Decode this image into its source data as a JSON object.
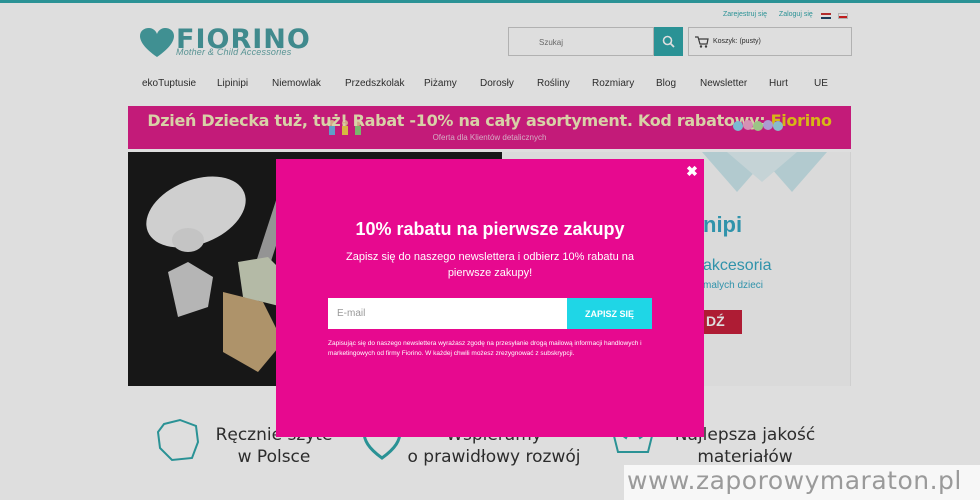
{
  "header": {
    "logo_name": "FIORINO",
    "logo_tagline": "Mother & Child Accessories",
    "links": {
      "register": "Zarejestruj się",
      "login": "Zaloguj się"
    },
    "search_placeholder": "Szukaj",
    "cart_label": "Koszyk: (pusty)"
  },
  "nav": {
    "items": [
      "ekoTuptusie",
      "Lipinipi",
      "Niemowlak",
      "Przedszkolak",
      "Piżamy",
      "Dorosły",
      "Rośliny",
      "Rozmiary",
      "Blog",
      "Newsletter",
      "Hurt",
      "UE"
    ]
  },
  "promo": {
    "text": "Dzień Dziecka tuż, tuż! Rabat -10% na cały asortyment. Kod rabatowy:",
    "code": "Fiorino",
    "subtext": "Oferta dla Klientów detalicznych"
  },
  "hero": {
    "brand": "nipi",
    "line1": "akcesoria",
    "line2": "malych dzieci",
    "button": "DŹ"
  },
  "features": {
    "f1_line1": "Ręcznie szyte",
    "f1_line2": "w Polsce",
    "f2_line1": "Wspieramy",
    "f2_line2": "o prawidłowy rozwój",
    "f3_line1": "Najlepsza jakość",
    "f3_line2": "materiałów"
  },
  "modal": {
    "close_label": "✖",
    "title": "10% rabatu na pierwsze zakupy",
    "subtitle": "Zapisz się do naszego newslettera i odbierz 10% rabatu na pierwsze zakupy!",
    "email_placeholder": "E-mail",
    "button_label": "ZAPISZ SIĘ",
    "consent": "Zapisując się do naszego newslettera wyrażasz zgodę na przesyłanie drogą mailową informacji handlowych i marketingowych od firmy Fiorino. W każdej chwili możesz zrezygnować z subskrypcji."
  },
  "watermark": "www.zaporowymaraton.pl",
  "colors": {
    "accent": "#31a8ac",
    "promo_bg": "#e01f8c",
    "modal_bg": "#e7098f",
    "button_cyan": "#1fd6e6"
  }
}
